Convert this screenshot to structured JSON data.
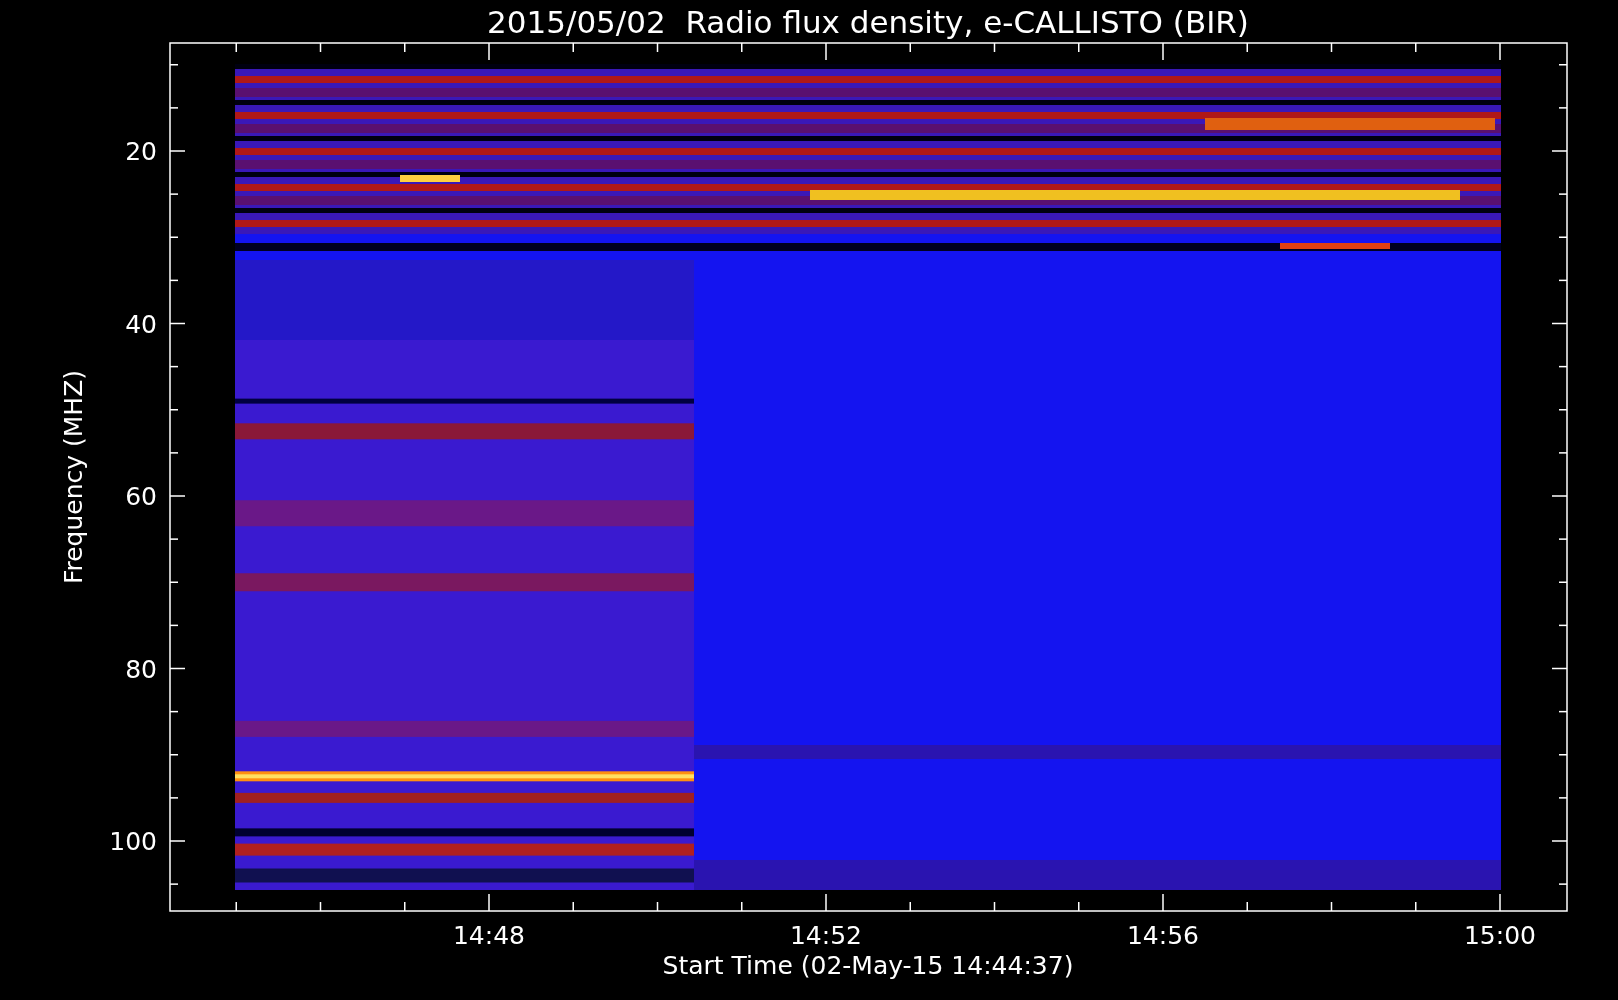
{
  "title": "2015/05/02  Radio flux density, e-CALLISTO (BIR)",
  "y_axis": {
    "label": "Frequency (MHZ)",
    "ticks": [
      "20",
      "40",
      "60",
      "80",
      "100"
    ]
  },
  "x_axis": {
    "label": "Start Time (02-May-15 14:44:37)",
    "ticks": [
      "14:48",
      "14:52",
      "14:56",
      "15:00"
    ]
  }
}
